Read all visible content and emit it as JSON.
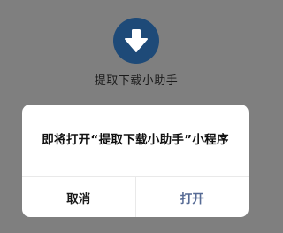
{
  "app": {
    "icon": "download-arrow-icon",
    "name": "提取下载小助手"
  },
  "dialog": {
    "message": "即将打开“提取下载小助手”小程序",
    "cancel_label": "取消",
    "confirm_label": "打开"
  },
  "colors": {
    "overlay": "#7f7f7f",
    "icon_bg": "#1e4a78",
    "confirm_text": "#576b95",
    "dialog_bg": "#ffffff"
  }
}
